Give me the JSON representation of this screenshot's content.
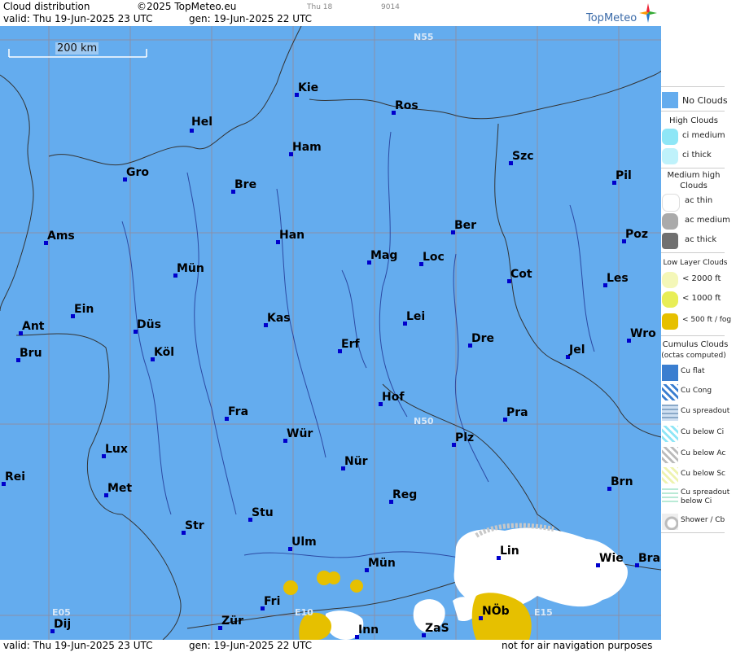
{
  "header": {
    "title": "Cloud distribution",
    "copyright": "©2025 TopMeteo.eu",
    "small_day": "Thu 18",
    "small_code": "9014",
    "valid": "valid:  Thu  19-Jun-2025  23 UTC",
    "gen": "gen: 19-Jun-2025 22 UTC",
    "brand": "TopMeteo"
  },
  "footer": {
    "valid": "valid:  Thu  19-Jun-2025  23 UTC",
    "gen": "gen: 19-Jun-2025 22 UTC",
    "note": "not for air navigation purposes"
  },
  "map": {
    "scale_label": "200 km",
    "grid_labels": [
      "N55",
      "N50",
      "E05",
      "E10",
      "E15"
    ],
    "cities": [
      "Hel",
      "Kie",
      "Ros",
      "Ham",
      "Szc",
      "Gro",
      "Bre",
      "Pil",
      "Ams",
      "Han",
      "Ber",
      "Poz",
      "Mag",
      "Loc",
      "Mün",
      "Cot",
      "Les",
      "Ein",
      "Ant",
      "Kas",
      "Lei",
      "Düs",
      "Dre",
      "Wro",
      "Bru",
      "Köl",
      "Erf",
      "Jel",
      "Hof",
      "Fra",
      "Pra",
      "Wür",
      "Plz",
      "Lux",
      "Nür",
      "Rei",
      "Met",
      "Reg",
      "Brn",
      "Stu",
      "Str",
      "Lin",
      "Ulm",
      "Wie",
      "Bra",
      "Mün",
      "Fri",
      "NÖb",
      "Dij",
      "Zür",
      "Inn",
      "ZaS"
    ]
  },
  "legend": {
    "no_clouds": "No Clouds",
    "high_clouds": "High Clouds",
    "ci_medium": "ci medium",
    "ci_thick": "ci thick",
    "medium_high": "Medium high Clouds",
    "ac_thin": "ac thin",
    "ac_medium": "ac medium",
    "ac_thick": "ac thick",
    "low_layer": "Low Layer Clouds",
    "lt2000": "< 2000 ft",
    "lt1000": "< 1000 ft",
    "lt500": "< 500 ft / fog",
    "cumulus": "Cumulus Clouds",
    "cumulus_sub": "(octas computed)",
    "cu_flat": "Cu flat",
    "cu_cong": "Cu Cong",
    "cu_spreadout": "Cu spreadout",
    "cu_below_ci": "Cu below Ci",
    "cu_below_ac": "Cu below Ac",
    "cu_below_sc": "Cu below Sc",
    "cu_spreadout_below_ci": "Cu spreadout below Ci",
    "shower_cb": "Shower / Cb"
  },
  "colors": {
    "no_clouds": "#64acee",
    "fog": "#e6c000",
    "cloud_white": "#ffffff",
    "city_dot": "#0000cc"
  }
}
